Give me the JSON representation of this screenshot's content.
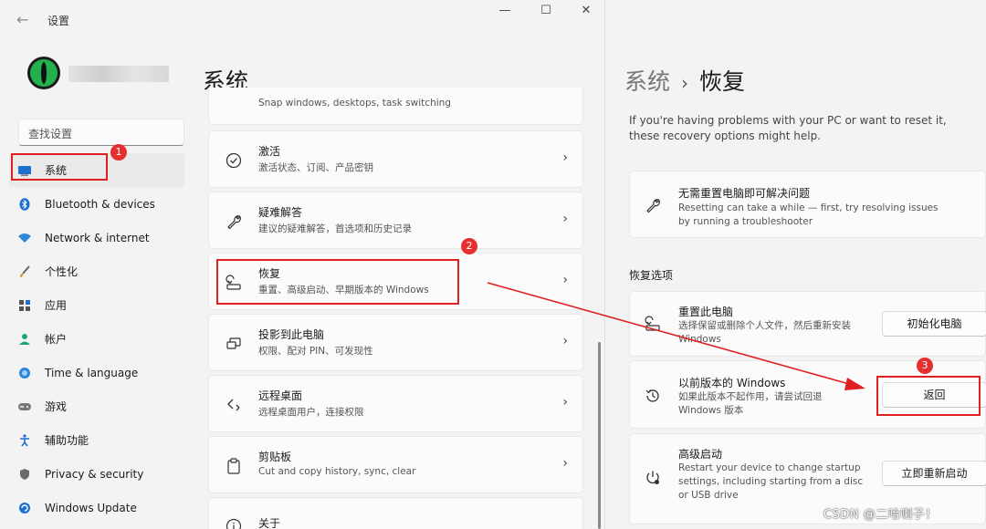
{
  "window": {
    "title": "设置",
    "controls": {
      "minimize": "—",
      "maximize": "☐",
      "close": "✕"
    }
  },
  "sidebar": {
    "search_placeholder": "查找设置",
    "items": [
      {
        "label": "系统",
        "icon": "monitor-icon"
      },
      {
        "label": "Bluetooth & devices",
        "icon": "bluetooth-icon"
      },
      {
        "label": "Network & internet",
        "icon": "wifi-icon"
      },
      {
        "label": "个性化",
        "icon": "brush-icon"
      },
      {
        "label": "应用",
        "icon": "apps-icon"
      },
      {
        "label": "帐户",
        "icon": "person-icon"
      },
      {
        "label": "Time & language",
        "icon": "globe-clock-icon"
      },
      {
        "label": "游戏",
        "icon": "gamepad-icon"
      },
      {
        "label": "辅助功能",
        "icon": "accessibility-icon"
      },
      {
        "label": "Privacy & security",
        "icon": "shield-icon"
      },
      {
        "label": "Windows Update",
        "icon": "update-icon"
      }
    ]
  },
  "middle": {
    "title": "系统",
    "cards": [
      {
        "title": "",
        "subtitle": "Snap windows, desktops, task switching",
        "icon": ""
      },
      {
        "title": "激活",
        "subtitle": "激活状态、订阅、产品密钥",
        "icon": "check-circle-icon"
      },
      {
        "title": "疑难解答",
        "subtitle": "建议的疑难解答，首选项和历史记录",
        "icon": "wrench-icon"
      },
      {
        "title": "恢复",
        "subtitle": "重置、高级启动、早期版本的 Windows",
        "icon": "recovery-icon"
      },
      {
        "title": "投影到此电脑",
        "subtitle": "权限、配对 PIN、可发现性",
        "icon": "project-icon"
      },
      {
        "title": "远程桌面",
        "subtitle": "远程桌面用户，连接权限",
        "icon": "remote-icon"
      },
      {
        "title": "剪贴板",
        "subtitle": "Cut and copy history, sync, clear",
        "icon": "clipboard-icon"
      },
      {
        "title": "关于",
        "subtitle": "",
        "icon": "info-icon"
      }
    ]
  },
  "right": {
    "breadcrumb": {
      "parent": "系统",
      "separator": "›",
      "current": "恢复"
    },
    "description": "If you're having problems with your PC or want to reset it, these recovery options might help.",
    "troubleshoot": {
      "title": "无需重置电脑即可解决问题",
      "subtitle": "Resetting can take a while — first, try resolving issues by running a troubleshooter"
    },
    "section_title": "恢复选项",
    "options": [
      {
        "title": "重置此电脑",
        "subtitle": "选择保留或删除个人文件，然后重新安装 Windows",
        "button": "初始化电脑",
        "icon": "reset-pc-icon"
      },
      {
        "title": "以前版本的 Windows",
        "subtitle": "如果此版本不起作用，请尝试回退 Windows 版本",
        "button": "返回",
        "icon": "history-icon"
      },
      {
        "title": "高级启动",
        "subtitle": "Restart your device to change startup settings, including starting from a disc or USB drive",
        "button": "立即重新启动",
        "icon": "advanced-startup-icon"
      }
    ]
  },
  "annotations": {
    "badges": [
      "1",
      "2",
      "3"
    ],
    "color": "#e02020"
  },
  "watermark": "CSDN @二哈喇子！"
}
